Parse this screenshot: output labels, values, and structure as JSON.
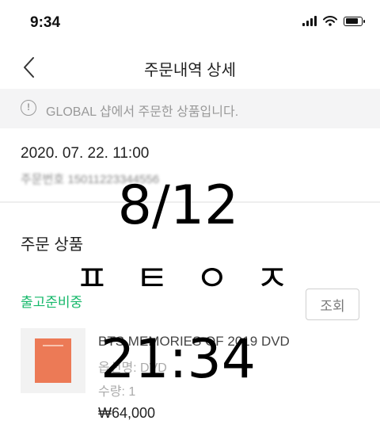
{
  "status_bar": {
    "time": "9:34"
  },
  "header": {
    "title": "주문내역 상세"
  },
  "notice": {
    "icon": "info-icon",
    "text": "GLOBAL 샵에서 주문한 상품입니다."
  },
  "order": {
    "date": "2020. 07. 22. 11:00",
    "number_label": "주문번호 15011223344556"
  },
  "section": {
    "title": "주문 상품"
  },
  "shipping": {
    "status": "출고준비중",
    "view_label": "조회",
    "status_color": "#15b86a"
  },
  "product": {
    "name": "BTS MEMORIES OF 2019 DVD",
    "option": "옵션명: DVD",
    "quantity": "수량: 1",
    "price": "₩64,000",
    "thumb_color": "#ec7a56"
  },
  "overlay": {
    "date": "8/12",
    "letters": [
      "ㅍ",
      "ㅌ",
      "ㅇ",
      "ㅈ"
    ],
    "time": "21:34"
  }
}
